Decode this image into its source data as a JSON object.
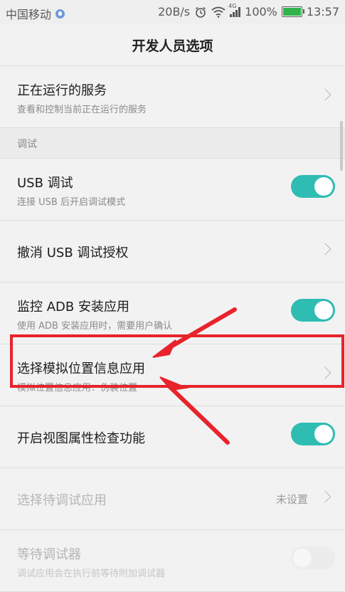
{
  "status_bar": {
    "carrier": "中国移动",
    "net_speed": "20B/s",
    "network_type": "4G",
    "battery": "100%",
    "battery_level": 1.0,
    "time": "13:57",
    "icons": [
      "carrier-badge-icon",
      "alarm-icon",
      "wifi-icon",
      "signal-icon",
      "battery-icon"
    ]
  },
  "header": {
    "title": "开发人员选项"
  },
  "items": [
    {
      "title": "正在运行的服务",
      "subtitle": "查看和控制当前正在运行的服务",
      "control": "chevron"
    },
    {
      "section": "调试"
    },
    {
      "title": "USB 调试",
      "subtitle": "连接 USB 后开启调试模式",
      "control": "toggle",
      "state": "on"
    },
    {
      "title": "撤消 USB 调试授权",
      "control": "chevron"
    },
    {
      "title": "监控 ADB 安装应用",
      "subtitle": "使用 ADB 安装应用时，需要用户确认",
      "control": "toggle",
      "state": "on"
    },
    {
      "title": "选择模拟位置信息应用",
      "subtitle": "模拟位置信息应用：伪装位置",
      "control": "chevron"
    },
    {
      "title": "开启视图属性检查功能",
      "control": "toggle",
      "state": "on"
    },
    {
      "title": "选择待调试应用",
      "value": "未设置",
      "control": "chevron",
      "enabled": false
    },
    {
      "title": "等待调试器",
      "subtitle": "调试应用会在执行前等待附加调试器",
      "control": "toggle",
      "state": "off",
      "enabled": false
    }
  ],
  "annotation_color": "#e8232b",
  "accent_color": "#2fbcb3"
}
